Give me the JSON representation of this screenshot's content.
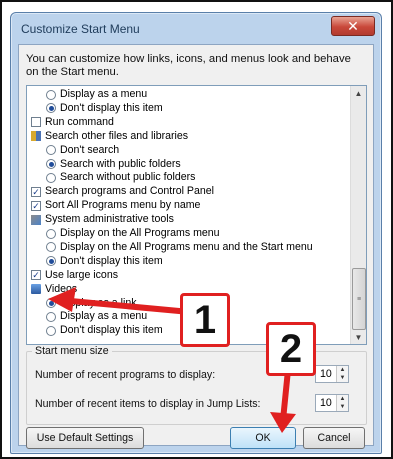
{
  "dialog": {
    "title": "Customize Start Menu",
    "close_glyph": "✕",
    "description": "You can customize how links, icons, and menus look and behave on the Start menu."
  },
  "list_items": [
    {
      "kind": "radio",
      "checked": false,
      "indent": true,
      "label": "Display as a menu"
    },
    {
      "kind": "radio",
      "checked": true,
      "indent": true,
      "label": "Don't display this item"
    },
    {
      "kind": "checkbox",
      "checked": false,
      "indent": false,
      "label": "Run command"
    },
    {
      "kind": "icon",
      "icon": "folder-search-icon",
      "indent": false,
      "label": "Search other files and libraries"
    },
    {
      "kind": "radio",
      "checked": false,
      "indent": true,
      "label": "Don't search"
    },
    {
      "kind": "radio",
      "checked": true,
      "indent": true,
      "label": "Search with public folders"
    },
    {
      "kind": "radio",
      "checked": false,
      "indent": true,
      "label": "Search without public folders"
    },
    {
      "kind": "checkbox",
      "checked": true,
      "indent": false,
      "label": "Search programs and Control Panel"
    },
    {
      "kind": "checkbox",
      "checked": true,
      "indent": false,
      "label": "Sort All Programs menu by name"
    },
    {
      "kind": "icon",
      "icon": "admin-tools-icon",
      "indent": false,
      "label": "System administrative tools"
    },
    {
      "kind": "radio",
      "checked": false,
      "indent": true,
      "label": "Display on the All Programs menu"
    },
    {
      "kind": "radio",
      "checked": false,
      "indent": true,
      "label": "Display on the All Programs menu and the Start menu"
    },
    {
      "kind": "radio",
      "checked": true,
      "indent": true,
      "label": "Don't display this item"
    },
    {
      "kind": "checkbox",
      "checked": true,
      "indent": false,
      "label": "Use large icons"
    },
    {
      "kind": "icon",
      "icon": "videos-icon",
      "indent": false,
      "label": "Videos"
    },
    {
      "kind": "radio",
      "checked": true,
      "indent": true,
      "label": "Display as a link"
    },
    {
      "kind": "radio",
      "checked": false,
      "indent": true,
      "label": "Display as a menu"
    },
    {
      "kind": "radio",
      "checked": false,
      "indent": true,
      "label": "Don't display this item"
    }
  ],
  "start_menu_size": {
    "title": "Start menu size",
    "recent_programs_label": "Number of recent programs to display:",
    "recent_programs_value": "10",
    "recent_items_label": "Number of recent items to display in Jump Lists:",
    "recent_items_value": "10"
  },
  "buttons": {
    "default": "Use Default Settings",
    "ok": "OK",
    "cancel": "Cancel"
  },
  "annotations": {
    "callout_1": "1",
    "callout_2": "2",
    "color": "#e02020"
  },
  "scroll": {
    "up_glyph": "▲",
    "down_glyph": "▼",
    "thumb_grip": "≡"
  }
}
